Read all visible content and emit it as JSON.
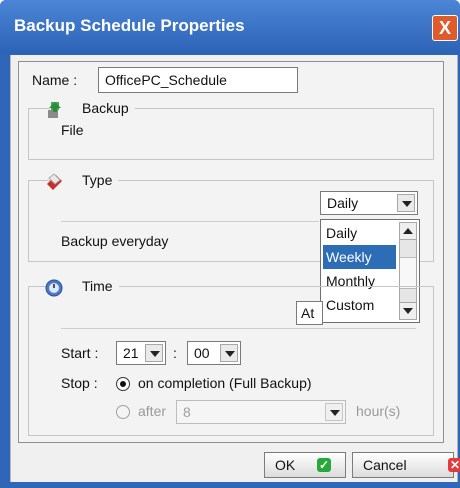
{
  "window": {
    "title": "Backup Schedule Properties",
    "close_label": "X"
  },
  "name": {
    "label": "Name :",
    "value": "OfficePC_Schedule"
  },
  "backup_section": {
    "title": "Backup",
    "item": "File"
  },
  "type_section": {
    "title": "Type",
    "selected": "Daily",
    "description": "Backup everyday",
    "options": [
      "Daily",
      "Weekly",
      "Monthly",
      "Custom"
    ],
    "highlighted": "Weekly"
  },
  "time_section": {
    "title": "Time",
    "at_label": "At",
    "start_label": "Start :",
    "start_hour": "21",
    "start_sep": ":",
    "start_minute": "00",
    "stop_label": "Stop :",
    "stop_option1": "on completion (Full Backup)",
    "stop_option2_prefix": "after",
    "after_value": "8",
    "hours_label": "hour(s)"
  },
  "buttons": {
    "ok": "OK",
    "cancel": "Cancel"
  },
  "colors": {
    "title_bar": "#2f66b8",
    "selection": "#2d6db6",
    "ok_icon": "#27a83a",
    "cancel_icon": "#e33b3b"
  },
  "icons": {
    "backup": "backup-icon",
    "type": "type-icon",
    "time": "clock-icon"
  }
}
